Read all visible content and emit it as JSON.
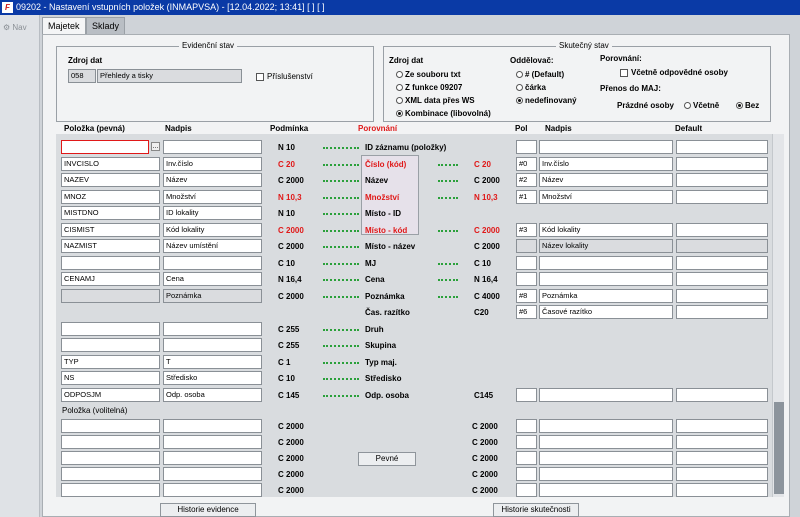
{
  "window": {
    "title": "09202 - Nastavení vstupních položek (INMAPVSA) - [12.04.2022; 13:41]  [ ]  [ ]",
    "app_icon": "F"
  },
  "leftnav": {
    "label": "Nav"
  },
  "tabs": [
    {
      "label": "Majetek",
      "active": true
    },
    {
      "label": "Sklady",
      "active": false
    }
  ],
  "evidencni": {
    "title": "Evidenční stav",
    "zdroj_label": "Zdroj dat",
    "zdroj_code": "058",
    "zdroj_value": "Přehledy a tisky",
    "prislusenstvi_label": "Příslušenství"
  },
  "skutecny": {
    "title": "Skutečný stav",
    "zdroj_label": "Zdroj dat",
    "zdroj_options": [
      {
        "label": "Ze souboru txt",
        "selected": false
      },
      {
        "label": "Z funkce 09207",
        "selected": false
      },
      {
        "label": "XML data přes WS",
        "selected": false
      },
      {
        "label": "Kombinace (libovolná)",
        "selected": true
      }
    ],
    "oddelovac_label": "Oddělovač:",
    "oddelovac_options": [
      {
        "label": "# (Default)",
        "selected": false
      },
      {
        "label": "čárka",
        "selected": false
      },
      {
        "label": "nedefinovaný",
        "selected": true
      }
    ],
    "porovnani_label": "Porovnání:",
    "vcetne_label": "Včetně odpovědné osoby",
    "prenos_label": "Přenos do MAJ:",
    "prazdne_label": "Prázdné osoby",
    "prazdne_options": [
      {
        "label": "Včetně",
        "selected": false
      },
      {
        "label": "Bez",
        "selected": true
      }
    ]
  },
  "headers": {
    "polozka": "Položka  (pevná)",
    "nadpis": "Nadpis",
    "podminka": "Podmínka",
    "porovnani": "Porovnání",
    "pol": "Pol",
    "nadpis2": "Nadpis",
    "default": "Default",
    "volitelna": "Položka  (volitelná)"
  },
  "rows": [
    {
      "polozka": "",
      "nadpis": "",
      "podminka": "N 10",
      "label": "ID záznamu (položky)",
      "skut_cond": "",
      "pol": "",
      "nadpis2": "",
      "red": false,
      "dots": true,
      "right_dots": false,
      "focus": true
    },
    {
      "polozka": "INVCISLO",
      "nadpis": "Inv.číslo",
      "podminka": "C 20",
      "label": "Číslo (kód)",
      "skut_cond": "C 20",
      "pol": "#0",
      "nadpis2": "Inv.číslo",
      "red": true,
      "dots": true,
      "right_dots": true
    },
    {
      "polozka": "NAZEV",
      "nadpis": "Název",
      "podminka": "C 2000",
      "label": "Název",
      "skut_cond": "C 2000",
      "pol": "#2",
      "nadpis2": "Název",
      "red": false,
      "dots": true,
      "right_dots": true
    },
    {
      "polozka": "MNOZ",
      "nadpis": "Množství",
      "podminka": "N 10,3",
      "label": "Množství",
      "skut_cond": "N 10,3",
      "pol": "#1",
      "nadpis2": "Množství",
      "red": true,
      "dots": true,
      "right_dots": true
    },
    {
      "polozka": "MISTDNO",
      "nadpis": "ID lokality",
      "podminka": "N 10",
      "label": "Místo - ID",
      "skut_cond": "",
      "pol": "",
      "nadpis2": "",
      "red": false,
      "dots": true,
      "right_dots": false,
      "no_right": true
    },
    {
      "polozka": "CISMIST",
      "nadpis": "Kód lokality",
      "podminka": "C 2000",
      "label": "Místo - kód",
      "skut_cond": "C 2000",
      "pol": "#3",
      "nadpis2": "Kód lokality",
      "red": true,
      "dots": true,
      "right_dots": true
    },
    {
      "polozka": "NAZMIST",
      "nadpis": "Název umístění",
      "podminka": "C 2000",
      "label": "Místo - název",
      "skut_cond": "C 2000",
      "pol": "",
      "nadpis2": "Název lokality",
      "red": false,
      "dots": true,
      "right_dots": false,
      "gray_right": true
    },
    {
      "polozka": "",
      "nadpis": "",
      "podminka": "C 10",
      "label": "MJ",
      "skut_cond": "C 10",
      "pol": "",
      "nadpis2": "",
      "red": false,
      "dots": true,
      "right_dots": true
    },
    {
      "polozka": "CENAMJ",
      "nadpis": "Cena",
      "podminka": "N 16,4",
      "label": "Cena",
      "skut_cond": "N 16,4",
      "pol": "",
      "nadpis2": "",
      "red": false,
      "dots": true,
      "right_dots": true
    },
    {
      "polozka": "",
      "nadpis": "Poznámka",
      "podminka": "C 2000",
      "label": "Poznámka",
      "skut_cond": "C 4000",
      "pol": "#8",
      "nadpis2": "Poznámka",
      "red": false,
      "dots": true,
      "right_dots": true,
      "gray_left": true
    },
    {
      "polozka": "",
      "nadpis": "",
      "podminka": "",
      "label": "Čas. razítko",
      "skut_cond": "C20",
      "pol": "#6",
      "nadpis2": "Časové razítko",
      "red": false,
      "dots": false,
      "right_dots": false,
      "no_left": true
    },
    {
      "polozka": "",
      "nadpis": "",
      "podminka": "C 255",
      "label": "Druh",
      "skut_cond": "",
      "pol": "",
      "nadpis2": "",
      "red": false,
      "dots": true,
      "right_dots": false,
      "no_right": true
    },
    {
      "polozka": "",
      "nadpis": "",
      "podminka": "C 255",
      "label": "Skupina",
      "skut_cond": "",
      "pol": "",
      "nadpis2": "",
      "red": false,
      "dots": true,
      "right_dots": false,
      "no_right": true
    },
    {
      "polozka": "TYP",
      "nadpis": "T",
      "podminka": "C 1",
      "label": "Typ maj.",
      "skut_cond": "",
      "pol": "",
      "nadpis2": "",
      "red": false,
      "dots": true,
      "right_dots": false,
      "no_right": true
    },
    {
      "polozka": "NS",
      "nadpis": "Středisko",
      "podminka": "C 10",
      "label": "Středisko",
      "skut_cond": "",
      "pol": "",
      "nadpis2": "",
      "red": false,
      "dots": true,
      "right_dots": false,
      "no_right": true
    },
    {
      "polozka": "ODPOSJM",
      "nadpis": "Odp. osoba",
      "podminka": "C 145",
      "label": "Odp. osoba",
      "skut_cond": "C145",
      "pol": "",
      "nadpis2": "",
      "red": false,
      "dots": true,
      "right_dots": false
    }
  ],
  "optional_rows": [
    {
      "podminka": "C 2000",
      "skut_cond": "C 2000"
    },
    {
      "podminka": "C 2000",
      "skut_cond": "C 2000"
    },
    {
      "podminka": "C 2000",
      "skut_cond": "C 2000"
    },
    {
      "podminka": "C 2000",
      "skut_cond": "C 2000"
    },
    {
      "podminka": "C 2000",
      "skut_cond": "C 2000"
    }
  ],
  "buttons": {
    "pevne": "Pevné",
    "historie_evidence": "Historie evidence",
    "historie_skutecnosti": "Historie skutečnosti",
    "ellipsis": "..."
  }
}
